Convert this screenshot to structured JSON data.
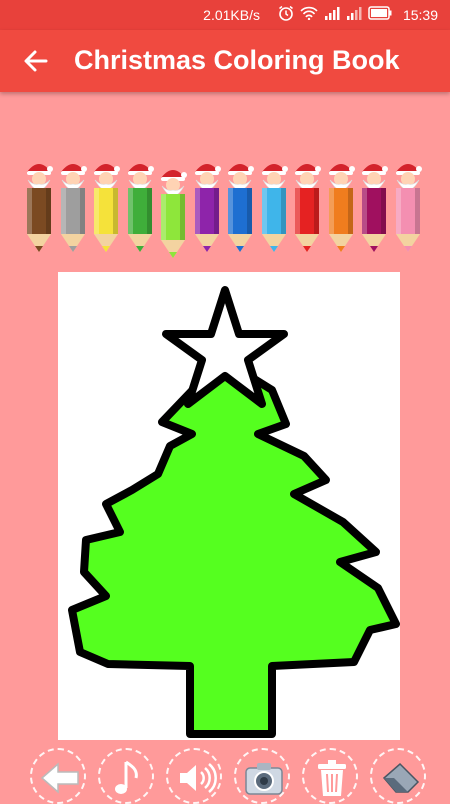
{
  "status_bar": {
    "speed": "2.01KB/s",
    "time": "15:39",
    "icons": [
      "alarm-icon",
      "wifi-icon",
      "signal-icon",
      "signal-icon",
      "battery-icon"
    ]
  },
  "app_bar": {
    "title": "Christmas Coloring Book",
    "back_icon": "arrow-left-icon"
  },
  "palette": {
    "selected_index": 4,
    "colors": [
      {
        "name": "brown",
        "hex": "#7b4a22"
      },
      {
        "name": "gray",
        "hex": "#9e9e9e"
      },
      {
        "name": "yellow",
        "hex": "#f5e23a"
      },
      {
        "name": "green",
        "hex": "#3fae3a"
      },
      {
        "name": "light-green",
        "hex": "#8ee63b"
      },
      {
        "name": "purple",
        "hex": "#8e24aa"
      },
      {
        "name": "blue",
        "hex": "#1e6fd1"
      },
      {
        "name": "sky-blue",
        "hex": "#3fb5ea"
      },
      {
        "name": "red",
        "hex": "#e52222"
      },
      {
        "name": "orange",
        "hex": "#f07d1e"
      },
      {
        "name": "magenta",
        "hex": "#a0105f"
      },
      {
        "name": "pink",
        "hex": "#f48fb1"
      }
    ]
  },
  "drawing": {
    "subject": "christmas-tree",
    "tree_fill": "#55ff1f",
    "star_fill": "#ffffff",
    "outline": "#000000"
  },
  "toolbar": {
    "tools": [
      "back-arrow-icon",
      "music-note-icon",
      "speaker-icon",
      "camera-icon",
      "trash-icon",
      "eraser-icon"
    ]
  }
}
